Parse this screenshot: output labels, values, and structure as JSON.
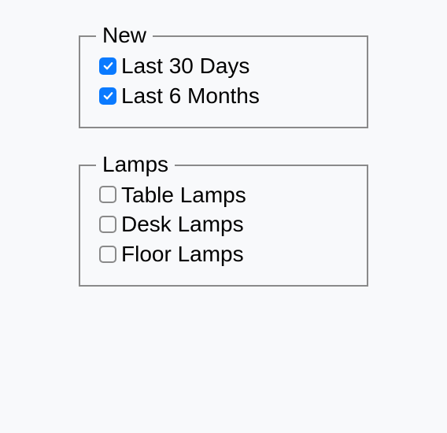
{
  "groups": [
    {
      "legend": "New",
      "options": [
        {
          "label": "Last 30 Days",
          "checked": true
        },
        {
          "label": "Last 6 Months",
          "checked": true
        }
      ]
    },
    {
      "legend": "Lamps",
      "options": [
        {
          "label": "Table Lamps",
          "checked": false
        },
        {
          "label": "Desk Lamps",
          "checked": false
        },
        {
          "label": "Floor Lamps",
          "checked": false
        }
      ]
    }
  ]
}
